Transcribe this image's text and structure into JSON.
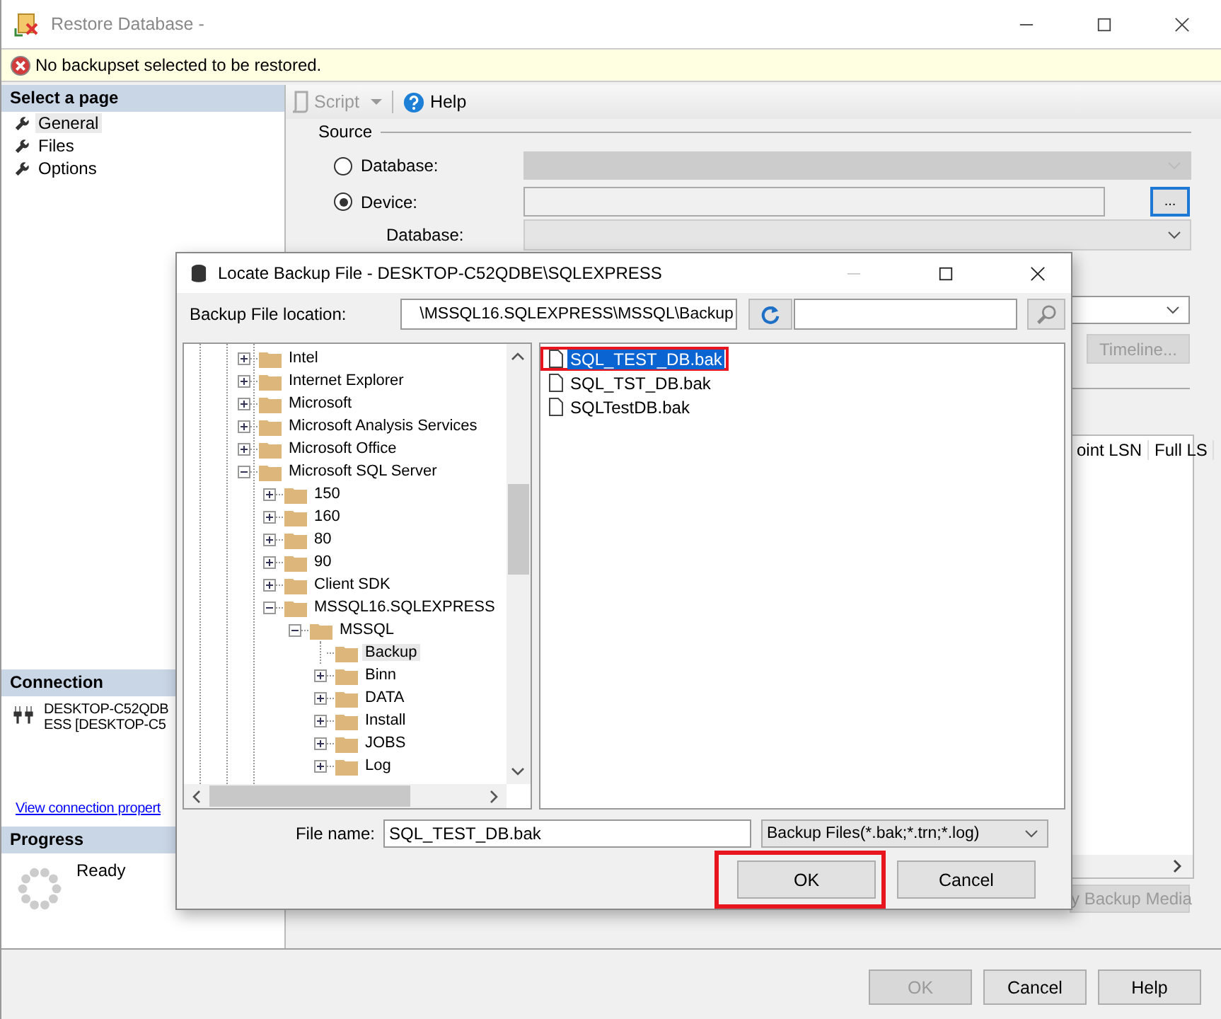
{
  "window": {
    "title": "Restore Database -"
  },
  "error_bar": {
    "message": "No backupset selected to be restored."
  },
  "sidebar": {
    "heading": "Select a page",
    "items": [
      {
        "label": "General",
        "selected": true
      },
      {
        "label": "Files",
        "selected": false
      },
      {
        "label": "Options",
        "selected": false
      }
    ]
  },
  "connection": {
    "heading": "Connection",
    "server_lines": [
      "DESKTOP-C52QDB",
      "ESS [DESKTOP-C5"
    ],
    "link": "View connection propert"
  },
  "progress": {
    "heading": "Progress",
    "status": "Ready"
  },
  "toolbar": {
    "script": "Script",
    "script_disabled": true,
    "help": "Help"
  },
  "source": {
    "heading": "Source",
    "options": [
      {
        "label": "Database:",
        "selected": false
      },
      {
        "label": "Device:",
        "selected": true
      }
    ],
    "browse": "...",
    "database_label": "Database:"
  },
  "timeline": {
    "label": "Timeline...",
    "disabled": true
  },
  "grid": {
    "columns": [
      "oint LSN",
      "Full LS"
    ]
  },
  "verify_button": {
    "label": "y Backup Media",
    "disabled": true
  },
  "buttons": [
    {
      "label": "OK",
      "disabled": true
    },
    {
      "label": "Cancel",
      "disabled": false
    },
    {
      "label": "Help",
      "disabled": false
    }
  ],
  "dialog": {
    "title": "Locate Backup File - DESKTOP-C52QDBE\\SQLEXPRESS",
    "location_label": "Backup File location:",
    "location": "\\MSSQL16.SQLEXPRESS\\MSSQL\\Backup",
    "tree": [
      {
        "label": "Intel",
        "expandable": true,
        "expanded": false,
        "selected": false
      },
      {
        "label": "Internet Explorer",
        "expandable": true,
        "expanded": false,
        "selected": false
      },
      {
        "label": "Microsoft",
        "expandable": true,
        "expanded": false,
        "selected": false
      },
      {
        "label": "Microsoft Analysis Services",
        "expandable": true,
        "expanded": false,
        "selected": false
      },
      {
        "label": "Microsoft Office",
        "expandable": true,
        "expanded": false,
        "selected": false
      },
      {
        "label": "Microsoft SQL Server",
        "expandable": true,
        "expanded": true,
        "selected": false,
        "children": [
          {
            "label": "150",
            "expandable": true,
            "expanded": false,
            "selected": false
          },
          {
            "label": "160",
            "expandable": true,
            "expanded": false,
            "selected": false
          },
          {
            "label": "80",
            "expandable": true,
            "expanded": false,
            "selected": false
          },
          {
            "label": "90",
            "expandable": true,
            "expanded": false,
            "selected": false
          },
          {
            "label": "Client SDK",
            "expandable": true,
            "expanded": false,
            "selected": false
          },
          {
            "label": "MSSQL16.SQLEXPRESS",
            "expandable": true,
            "expanded": true,
            "selected": false,
            "children": [
              {
                "label": "MSSQL",
                "expandable": true,
                "expanded": true,
                "selected": false,
                "children": [
                  {
                    "label": "Backup",
                    "expandable": false,
                    "selected": true
                  },
                  {
                    "label": "Binn",
                    "expandable": true,
                    "expanded": false,
                    "selected": false
                  },
                  {
                    "label": "DATA",
                    "expandable": true,
                    "expanded": false,
                    "selected": false
                  },
                  {
                    "label": "Install",
                    "expandable": true,
                    "expanded": false,
                    "selected": false
                  },
                  {
                    "label": "JOBS",
                    "expandable": true,
                    "expanded": false,
                    "selected": false
                  },
                  {
                    "label": "Log",
                    "expandable": true,
                    "expanded": false,
                    "selected": false
                  }
                ]
              }
            ]
          }
        ]
      }
    ],
    "files": [
      {
        "name": "SQL_TEST_DB.bak",
        "selected": true,
        "highlighted": true
      },
      {
        "name": "SQL_TST_DB.bak",
        "selected": false,
        "highlighted": false
      },
      {
        "name": "SQLTestDB.bak",
        "selected": false,
        "highlighted": false
      }
    ],
    "file_name_label": "File name:",
    "file_name": "SQL_TEST_DB.bak",
    "filter": "Backup Files(*.bak;*.trn;*.log)",
    "buttons": [
      {
        "label": "OK",
        "highlighted": true
      },
      {
        "label": "Cancel",
        "highlighted": false
      }
    ]
  }
}
